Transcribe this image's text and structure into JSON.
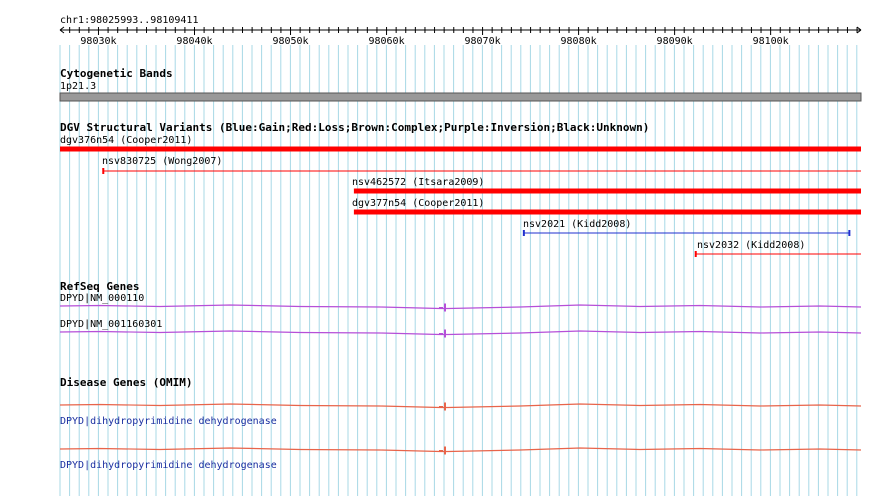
{
  "region": {
    "label": "chr1:98025993..98109411",
    "ticks": [
      "98030k",
      "98040k",
      "98050k",
      "98060k",
      "98070k",
      "98080k",
      "98090k",
      "98100k"
    ]
  },
  "cytoband": {
    "title": "Cytogenetic Bands",
    "band": "1p21.3"
  },
  "dgv": {
    "title": "DGV Structural Variants (Blue:Gain;Red:Loss;Brown:Complex;Purple:Inversion;Black:Unknown)",
    "features": [
      {
        "label": "dgv376n54 (Cooper2011)",
        "type": "loss",
        "style": "thick",
        "start": 98025993,
        "end": 98109411
      },
      {
        "label": "nsv830725 (Wong2007)",
        "type": "loss",
        "style": "thin",
        "start": 98030500,
        "end": 98109411
      },
      {
        "label": "nsv462572 (Itsara2009)",
        "type": "loss",
        "style": "thick",
        "start": 98056600,
        "end": 98109411
      },
      {
        "label": "dgv377n54 (Cooper2011)",
        "type": "loss",
        "style": "thick",
        "start": 98056600,
        "end": 98109411
      },
      {
        "label": "nsv2021 (Kidd2008)",
        "type": "gain",
        "style": "thin",
        "start": 98074300,
        "end": 98108200
      },
      {
        "label": "nsv2032 (Kidd2008)",
        "type": "loss",
        "style": "thin",
        "start": 98092200,
        "end": 98109411
      }
    ]
  },
  "refseq": {
    "title": "RefSeq Genes",
    "genes": [
      {
        "label": "DPYD|NM_000110"
      },
      {
        "label": "DPYD|NM_001160301"
      }
    ]
  },
  "omim": {
    "title": "Disease Genes (OMIM)",
    "genes": [
      {
        "label": "DPYD|dihydropyrimidine dehydrogenase"
      },
      {
        "label": "DPYD|dihydropyrimidine dehydrogenase"
      }
    ]
  },
  "colors": {
    "grid": "#a8d8e6",
    "loss": "#ff0000",
    "gain": "#1f2fcf",
    "refseq": "#b64fd8",
    "omim": "#e8644a",
    "cytoband": "#999999"
  }
}
